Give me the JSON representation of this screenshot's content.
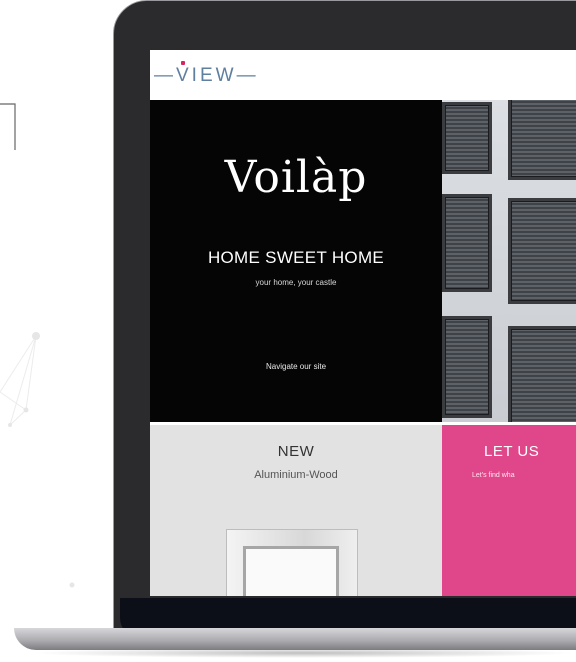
{
  "site": {
    "logo_text": "VIEW",
    "brand_name": "Voilàp",
    "hero": {
      "title": "HOME SWEET HOME",
      "subtitle": "your home, your castle",
      "nav_link": "Navigate our site"
    },
    "tiles": {
      "new": {
        "title": "NEW",
        "subtitle": "Aluminium-Wood"
      },
      "pink": {
        "title": "LET US",
        "subtitle": "Let's find wha"
      }
    }
  },
  "colors": {
    "accent_pink": "#e0478a",
    "brand_red": "#d6265e",
    "logo_blue": "#5f7fa0",
    "hero_bg": "#050505",
    "tile_grey": "#e2e2e2"
  }
}
